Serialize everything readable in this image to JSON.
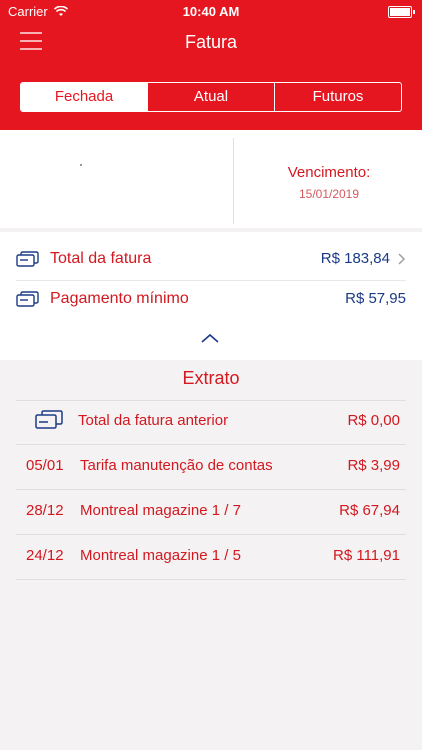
{
  "status_bar": {
    "carrier": "Carrier",
    "time": "10:40 AM"
  },
  "header": {
    "title": "Fatura"
  },
  "tabs": [
    {
      "label": "Fechada",
      "selected": true
    },
    {
      "label": "Atual",
      "selected": false
    },
    {
      "label": "Futuros",
      "selected": false
    }
  ],
  "summary": {
    "due_label": "Vencimento:",
    "due_date": "15/01/2019"
  },
  "totals": {
    "total_label": "Total da fatura",
    "total_value": "R$ 183,84",
    "min_label": "Pagamento mínimo",
    "min_value": "R$ 57,95"
  },
  "extrato": {
    "title": "Extrato",
    "rows": [
      {
        "date": "",
        "description": "Total da fatura anterior",
        "amount": "R$ 0,00"
      },
      {
        "date": "05/01",
        "description": "Tarifa manutenção de contas",
        "amount": "R$ 3,99"
      },
      {
        "date": "28/12",
        "description": "Montreal magazine 1 / 7",
        "amount": "R$ 67,94"
      },
      {
        "date": "24/12",
        "description": "Montreal magazine 1 / 5",
        "amount": "R$ 111,91"
      }
    ]
  },
  "colors": {
    "brand_red": "#e5161f",
    "value_blue": "#1b3a86"
  },
  "icons": [
    "wifi-icon",
    "battery-icon",
    "menu-icon",
    "card-icon",
    "chevron-right-icon",
    "chevron-up-icon"
  ]
}
